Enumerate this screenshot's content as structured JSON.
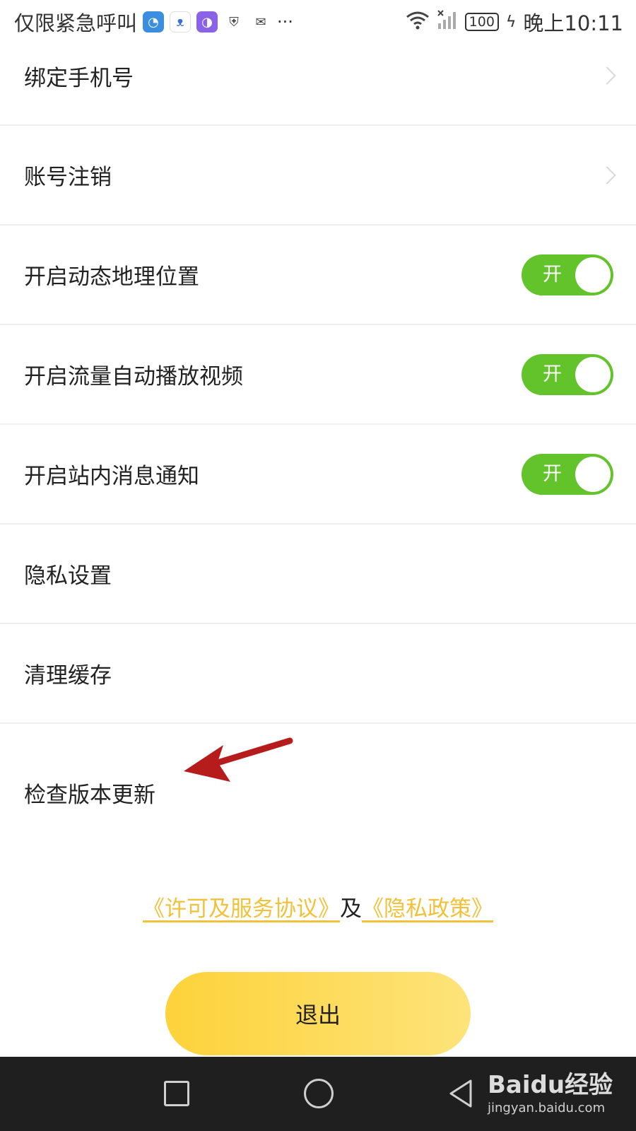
{
  "statusbar": {
    "left_text": "仅限紧急呼叫",
    "icons": [
      "chart-app-icon",
      "kids-app-icon",
      "purple-app-icon",
      "shield-icon",
      "wechat-icon"
    ],
    "more": "···",
    "battery": "100",
    "time": "晚上10:11"
  },
  "settings": {
    "items": [
      {
        "label": "绑定手机号",
        "control": "chevron"
      },
      {
        "label": "账号注销",
        "control": "chevron"
      },
      {
        "label": "开启动态地理位置",
        "control": "toggle",
        "toggle_text": "开",
        "on": true
      },
      {
        "label": "开启流量自动播放视频",
        "control": "toggle",
        "toggle_text": "开",
        "on": true
      },
      {
        "label": "开启站内消息通知",
        "control": "toggle",
        "toggle_text": "开",
        "on": true
      },
      {
        "label": "隐私设置",
        "control": "none"
      },
      {
        "label": "清理缓存",
        "control": "none"
      },
      {
        "label": "检查版本更新",
        "control": "none"
      }
    ]
  },
  "footer": {
    "license_link": "《许可及服务协议》",
    "and_text": "及",
    "privacy_link": "《隐私政策》",
    "logout_label": "退出"
  },
  "navbar": {
    "watermark": "Baidu经验",
    "watermark_sub": "jingyan.baidu.com"
  },
  "colors": {
    "toggle_on": "#62c42a",
    "link": "#f2c13a",
    "button": "#fdd23a",
    "arrow": "#b71c1c"
  }
}
